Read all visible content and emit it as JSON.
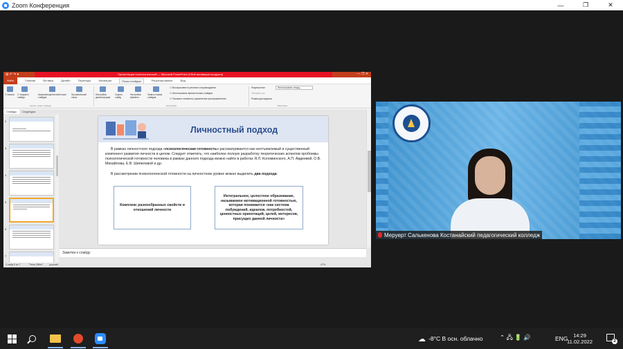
{
  "window": {
    "title": "Zoom Конференция",
    "controls": [
      "—",
      "❐",
      "✕"
    ]
  },
  "powerpoint": {
    "title_bar_text": "Презентация психологической — Microsoft PowerPoint (Сбой активации продукта)",
    "quick_access": "⊞ ↶ ↷ ▾",
    "title_controls": "— ❐ ✕",
    "tabs": [
      "Файл",
      "Главная",
      "Вставка",
      "Дизайн",
      "Переходы",
      "Анимация",
      "Показ слайдов",
      "Рецензирование",
      "Вид"
    ],
    "active_tab": "Показ слайдов",
    "ribbon": {
      "from_start": "С начала",
      "from_current": "С текущего слайда",
      "broadcast": "Широковещательный показ слайдов",
      "custom_show": "Произвольный показ",
      "setup": "Настройка демонстрации",
      "hide": "Скрыть слайд",
      "rehearse": "Настройка времени",
      "record": "Запись показа слайдов",
      "check_narration": "Воспроизвести речевое сопровождение",
      "check_timings": "Использовать время показа слайдов",
      "check_controls": "Показать элементы управления проигрывателем",
      "resolution": "Разрешение:",
      "resolution_value": "Использовать текущ...",
      "show_on": "Показать на:",
      "presenter_view": "Режим докладчика",
      "group_start": "Начать показ слайдов",
      "group_setup": "Настройка",
      "group_monitors": "Мониторы"
    },
    "panel_tabs": [
      "Слайды",
      "Структура"
    ],
    "thumb_numbers": [
      "2",
      "3",
      "4",
      "5",
      "6",
      "7"
    ],
    "slide": {
      "title": "Личностный подход",
      "p1_a": "В рамках личностного подхода ",
      "p1_b": "«психологическая готовность»",
      "p1_c": " рассматривается как неотъемлемый и существенный компонент развития личности в целом. Следует отметить, что наиболее полную разработку теоретических аспектов проблемы психологической готовности человека в рамках данного подхода можно найти в работах Я.Л. Коломинского, А.П. Авдеевой, О.В. Михайлова, Е.В. Шипиловой и др.",
      "p2_a": "В рассмотрении психологической готовности на личностном уровне можно выделить ",
      "p2_b": "два подхода",
      "p2_c": ":",
      "box_left": "Комплекс разнообразных свойств и отношений личности",
      "box_right": "Интегральное, целостное образование, называемое мотивационной готовностью, которая понимается «как система побуждений, идеалов, потребностей, ценностных ориентаций, целей, интересов, присущих данной личности»"
    },
    "notes_placeholder": "Заметки к слайду",
    "status": {
      "slide_of": "Слайд 5 из 7",
      "theme": "\"Тема Office\"",
      "language": "русский",
      "zoom": "47%"
    }
  },
  "participant": {
    "name": "Меруерт Салькенова Костанайский педагогический колледж"
  },
  "taskbar": {
    "weather": "-8°C  В осн. облачно",
    "tray_icons": "⌃ 🖧 🔋 🔊",
    "language": "ENG",
    "time": "14:29",
    "date": "11.02.2022",
    "notifications": "2"
  }
}
